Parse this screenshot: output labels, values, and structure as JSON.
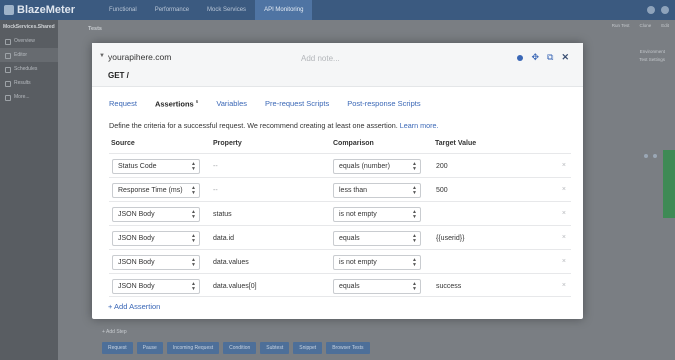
{
  "app": {
    "logo": "BlazeMeter",
    "top_tabs": [
      "Functional",
      "Performance",
      "Mock Services",
      "API Monitoring"
    ],
    "active_top_tab": 3
  },
  "sidebar": {
    "project_label": "MockServices.Shared",
    "items": [
      {
        "label": "Overview"
      },
      {
        "label": "Editor"
      },
      {
        "label": "Schedules"
      },
      {
        "label": "Results"
      },
      {
        "label": "More..."
      }
    ]
  },
  "background": {
    "section_title": "Tests",
    "tools": [
      "Run Test",
      "Clone",
      "Edit"
    ],
    "env_label": "Environment",
    "env_value": "Test Settings",
    "add_step": "+ Add Step",
    "step_buttons": [
      "Request",
      "Pause",
      "Incoming Request",
      "Condition",
      "Subtest",
      "Snippet",
      "Browser Tests"
    ]
  },
  "modal": {
    "url": "yourapihere.com",
    "note_placeholder": "Add note...",
    "method_path": "GET /",
    "tabs": [
      {
        "label": "Request"
      },
      {
        "label": "Assertions",
        "count": "6"
      },
      {
        "label": "Variables"
      },
      {
        "label": "Pre-request Scripts"
      },
      {
        "label": "Post-response Scripts"
      }
    ],
    "description": "Define the criteria for a successful request. We recommend creating at least one assertion.",
    "learn_more": "Learn more.",
    "columns": {
      "source": "Source",
      "property": "Property",
      "comparison": "Comparison",
      "target": "Target Value"
    },
    "rows": [
      {
        "source": "Status Code",
        "property": "--",
        "comparison": "equals (number)",
        "target": "200"
      },
      {
        "source": "Response Time (ms)",
        "property": "--",
        "comparison": "less than",
        "target": "500"
      },
      {
        "source": "JSON Body",
        "property": "status",
        "comparison": "is not empty",
        "target": ""
      },
      {
        "source": "JSON Body",
        "property": "data.id",
        "comparison": "equals",
        "target": "{{userid}}"
      },
      {
        "source": "JSON Body",
        "property": "data.values",
        "comparison": "is not empty",
        "target": ""
      },
      {
        "source": "JSON Body",
        "property": "data.values[0]",
        "comparison": "equals",
        "target": "success"
      }
    ],
    "add_assertion": "+ Add Assertion",
    "delete_glyph": "×"
  },
  "colors": {
    "accent": "#3a67b6",
    "topbar": "#3b5a80",
    "overlay": "#6f7378"
  }
}
